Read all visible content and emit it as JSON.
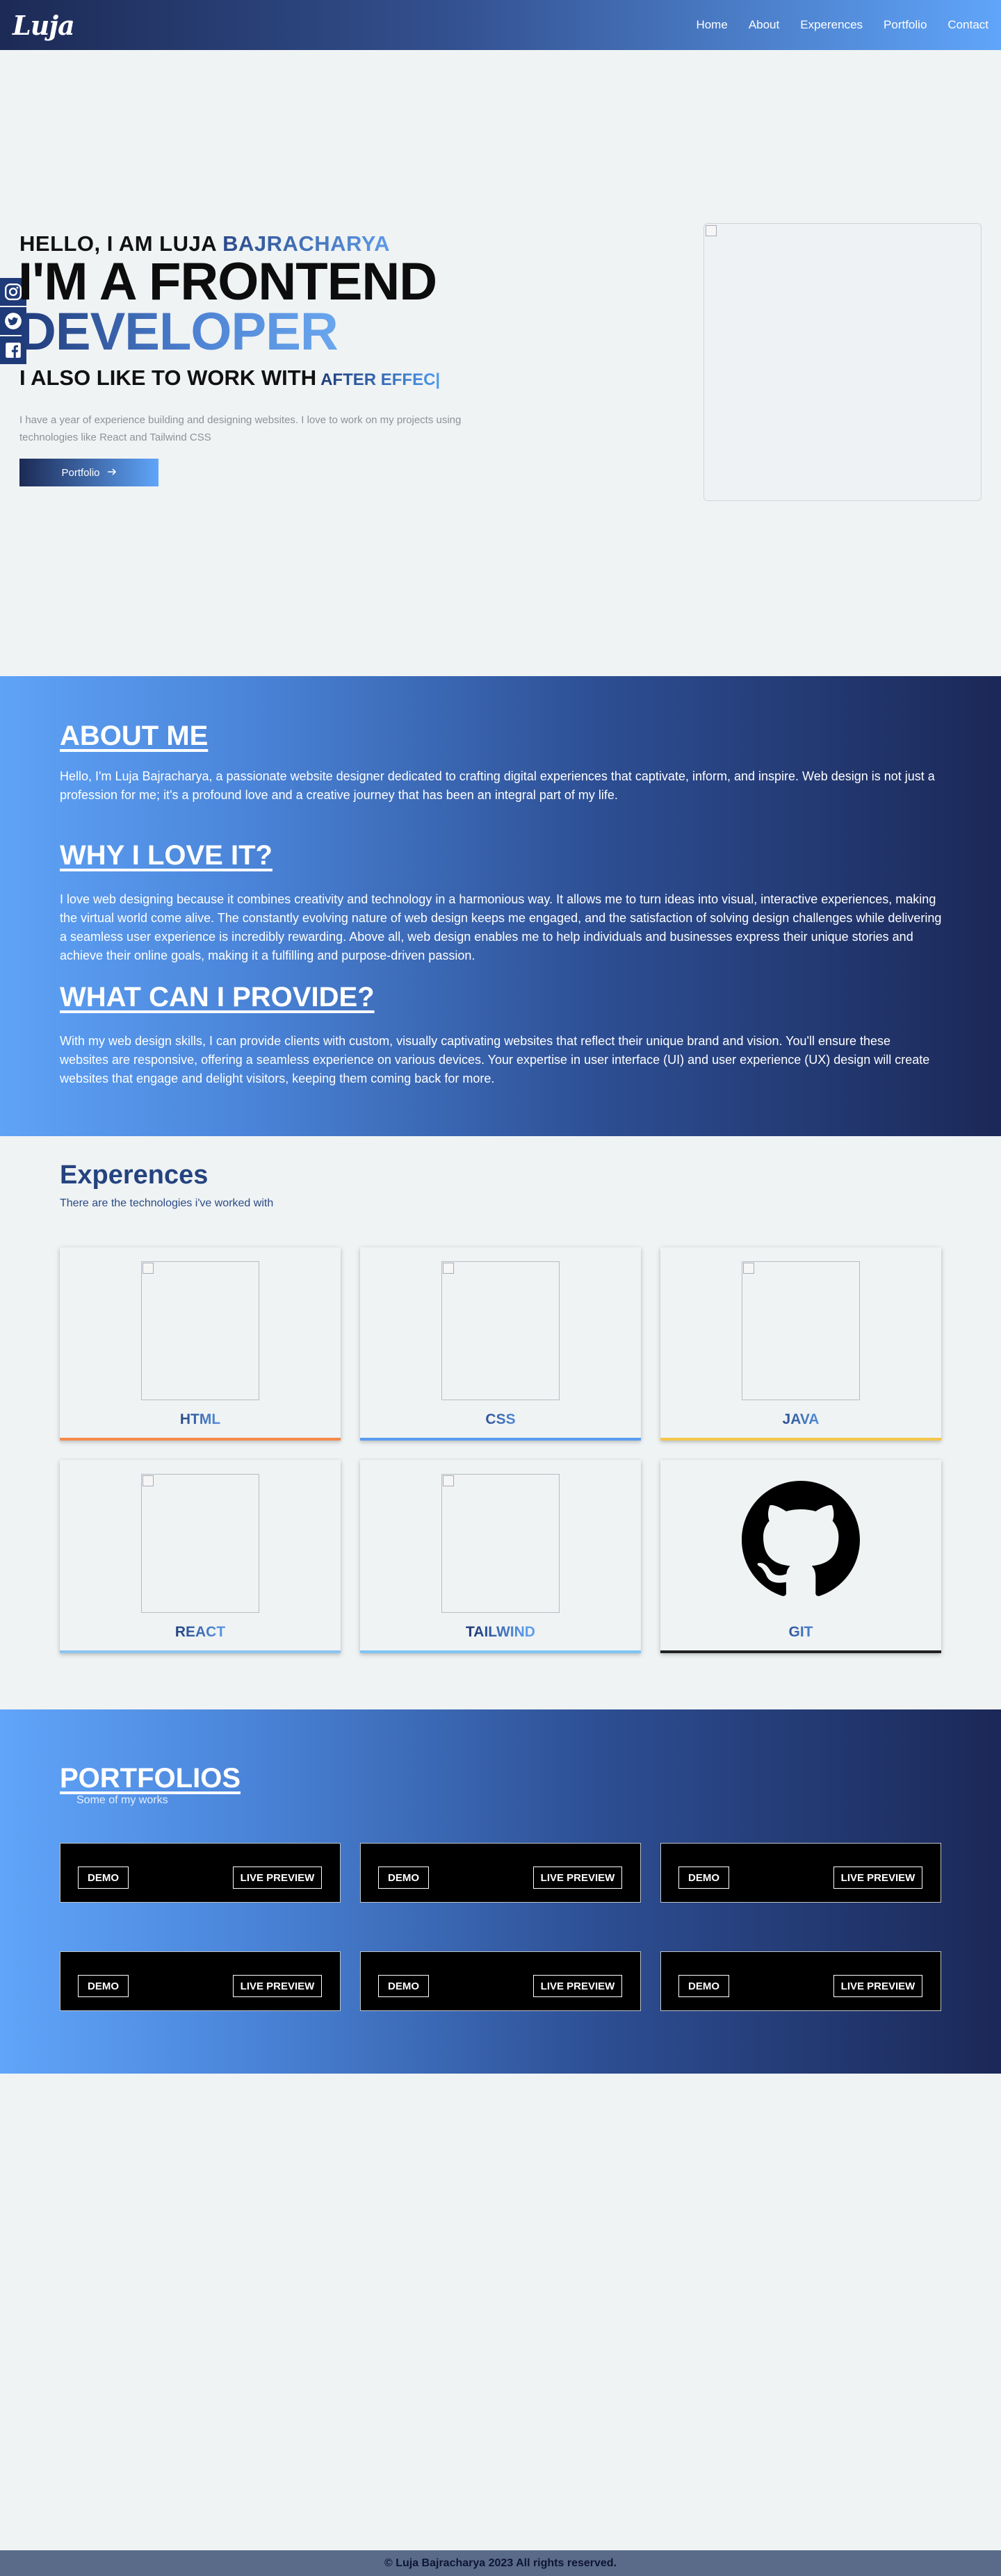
{
  "nav": {
    "logo": "Luja",
    "links": [
      "Home",
      "About",
      "Experences",
      "Portfolio",
      "Contact"
    ]
  },
  "hero": {
    "hello_prefix": "HELLO, I AM LUJA ",
    "hello_name": "BAJRACHARYA",
    "role_line1": "I'M A FRONTEND",
    "role_line2": "DEVELOPER",
    "also_text": "I ALSO LIKE TO WORK WITH",
    "also_effect": "AFTER EFFEC|",
    "description": "I have a year of experience building and designing websites. I love to work on my projects using technologies like React and Tailwind CSS",
    "button_label": "Portfolio",
    "button_icon": "arrow-right-icon",
    "social_icons": [
      "instagram-icon",
      "twitter-icon",
      "facebook-icon"
    ]
  },
  "about": {
    "sections": [
      {
        "heading": "ABOUT ME",
        "text": "Hello, I'm Luja Bajracharya, a passionate website designer dedicated to crafting digital experiences that captivate, inform, and inspire. Web design is not just a profession for me; it's a profound love and a creative journey that has been an integral part of my life."
      },
      {
        "heading": "WHY I LOVE IT?",
        "text": "I love web designing because it combines creativity and technology in a harmonious way. It allows me to turn ideas into visual, interactive experiences, making the virtual world come alive. The constantly evolving nature of web design keeps me engaged, and the satisfaction of solving design challenges while delivering a seamless user experience is incredibly rewarding. Above all, web design enables me to help individuals and businesses express their unique stories and achieve their online goals, making it a fulfilling and purpose-driven passion."
      },
      {
        "heading": "WHAT CAN I PROVIDE?",
        "text": "With my web design skills, I can provide clients with custom, visually captivating websites that reflect their unique brand and vision. You'll ensure these websites are responsive, offering a seamless experience on various devices. Your expertise in user interface (UI) and user experience (UX) design will create websites that engage and delight visitors, keeping them coming back for more."
      }
    ]
  },
  "experiences": {
    "title": "Experences",
    "subtitle": "There are the technologies i've worked with",
    "cards": [
      {
        "label": "HTML",
        "accent": "#f58a4b"
      },
      {
        "label": "CSS",
        "accent": "#5b9cf0"
      },
      {
        "label": "JAVA",
        "accent": "#f5c64b"
      },
      {
        "label": "REACT",
        "accent": "#8cc4f0"
      },
      {
        "label": "TAILWIND",
        "accent": "#7fc4f5"
      },
      {
        "label": "GIT",
        "accent": "#222222"
      }
    ]
  },
  "portfolio": {
    "title": "PORTFOLIOS",
    "subtitle": "Some of my works",
    "demo_label": "DEMO",
    "live_label": "LIVE PREVIEW"
  },
  "footer": {
    "text": "© Luja Bajracharya 2023 All rights reserved."
  }
}
